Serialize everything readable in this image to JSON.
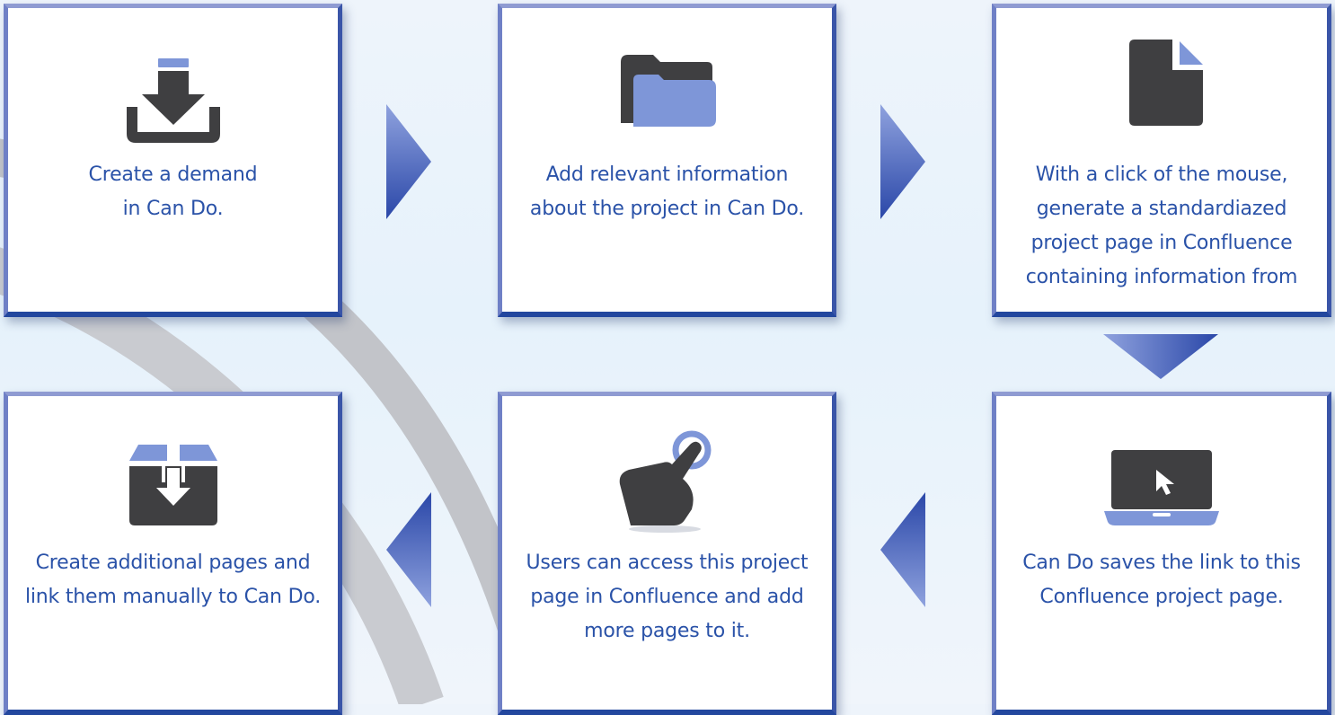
{
  "colors": {
    "text": "#2a52a8",
    "icon_dark": "#3f3f41",
    "icon_accent": "#7e96d8",
    "arrow_light": "#8fa2de",
    "arrow_dark": "#2a47a8"
  },
  "steps": [
    {
      "icon": "download-tray-icon",
      "text": "Create a demand\nin Can Do."
    },
    {
      "icon": "folder-icon",
      "text": "Add relevant information\nabout the project in Can Do."
    },
    {
      "icon": "document-icon",
      "text": "With a click of the mouse,\ngenerate a standardiazed\nproject page in Confluence\ncontaining information from"
    },
    {
      "icon": "laptop-cursor-icon",
      "text": "Can Do saves the link to this\nConfluence project page."
    },
    {
      "icon": "hand-tap-icon",
      "text": "Users can access this project\npage in Confluence and add\nmore pages to it."
    },
    {
      "icon": "archive-box-icon",
      "text": "Create additional pages and\nlink them manually to Can Do."
    }
  ]
}
